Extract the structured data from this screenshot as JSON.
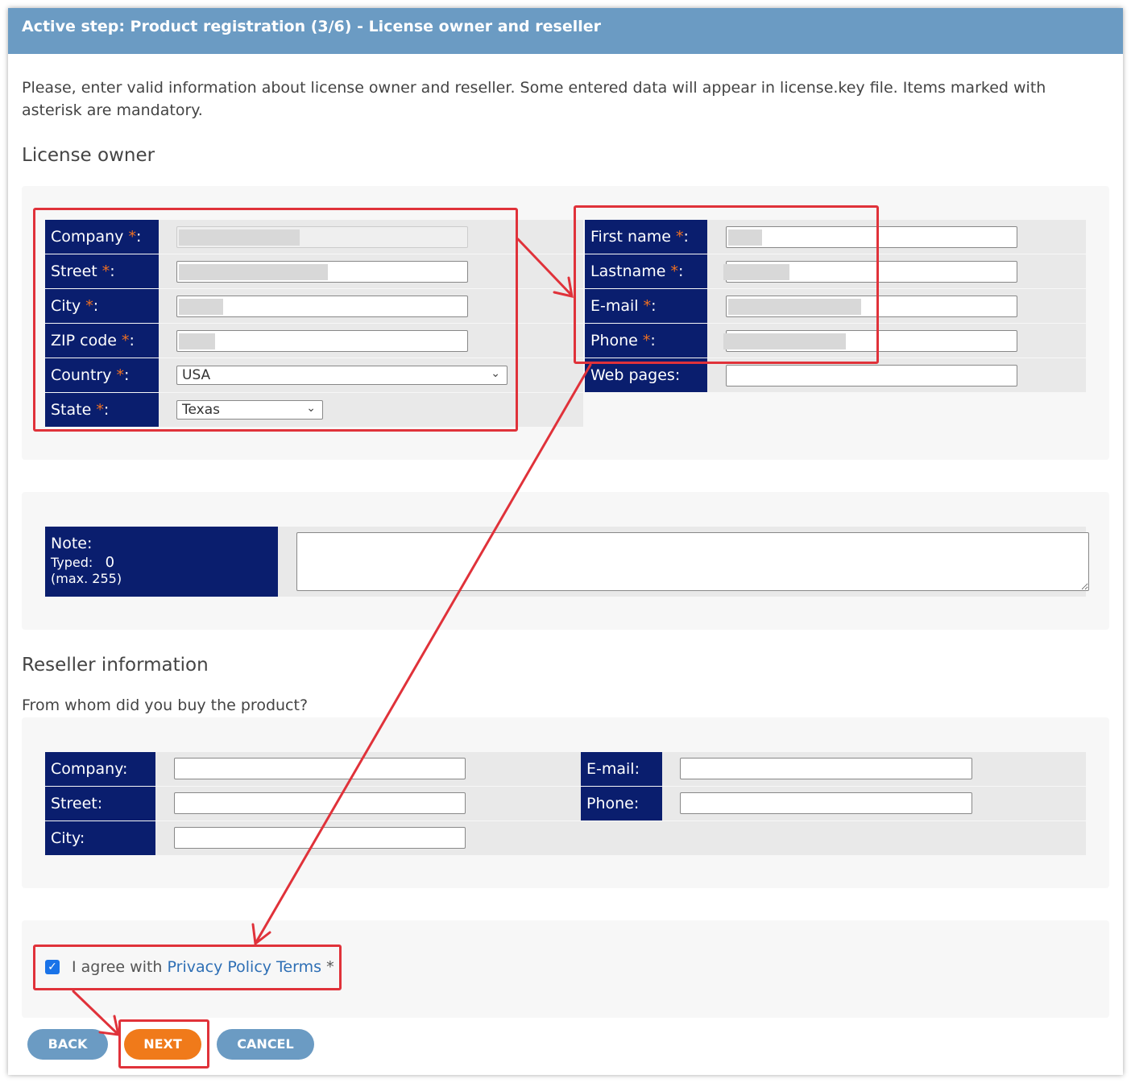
{
  "header": {
    "title": "Active step: Product registration (3/6) - License owner and reseller"
  },
  "intro": "Please, enter valid information about license owner and reseller. Some entered data will appear in license.key file. Items marked with asterisk are mandatory.",
  "license_owner": {
    "title": "License owner",
    "company_label": "Company",
    "street_label": "Street",
    "city_label": "City",
    "zip_label": "ZIP code",
    "country_label": "Country",
    "country_value": "USA",
    "state_label": "State",
    "state_value": "Texas",
    "first_name_label": "First name",
    "lastname_label": "Lastname",
    "email_label": "E-mail",
    "phone_label": "Phone",
    "web_label": "Web pages:",
    "required_mark": "*",
    "colon": ":"
  },
  "note": {
    "label": "Note:",
    "typed_label": "Typed:",
    "typed_value": "0",
    "max_label": "(max. 255)"
  },
  "reseller": {
    "title": "Reseller information",
    "question": "From whom did you buy the product?",
    "company_label": "Company:",
    "street_label": "Street:",
    "city_label": "City:",
    "email_label": "E-mail:",
    "phone_label": "Phone:"
  },
  "agree": {
    "prefix": "I agree with",
    "link": "Privacy Policy Terms",
    "suffix": "*",
    "checked": true
  },
  "buttons": {
    "back": "BACK",
    "next": "NEXT",
    "cancel": "CANCEL"
  },
  "colors": {
    "header": "#6b9bc3",
    "label_bg": "#0a1e6e",
    "accent_orange": "#f07a1a",
    "annotation_red": "#e0323a",
    "required": "#f07020"
  }
}
